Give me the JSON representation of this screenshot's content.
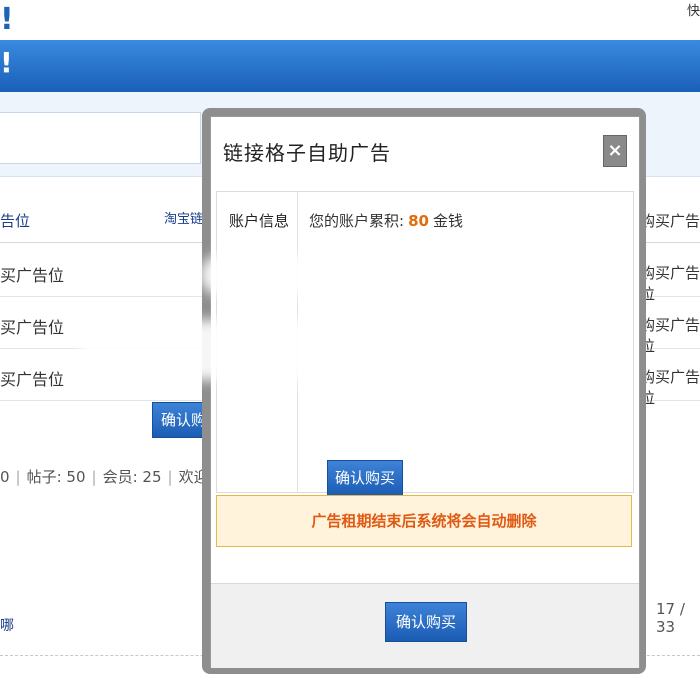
{
  "header": {
    "exclaim": "!",
    "corner_char": "快"
  },
  "table": {
    "head_left": "告位",
    "head_mid": "淘宝链接",
    "head_right": "购买广告",
    "rows": [
      {
        "left": "买广告位",
        "right": "购买广告位"
      },
      {
        "left": "买广告位",
        "right": "购买广告位"
      },
      {
        "left": "买广告位",
        "right": "购买广告位"
      }
    ]
  },
  "stats": {
    "p1": "0",
    "p2": "帖子: 50",
    "p3": "会员: 25",
    "p4": "欢迎新会"
  },
  "footer": {
    "left_text": "哪",
    "page_count": "17 / 33"
  },
  "buttons": {
    "confirm_buy": "确认购买",
    "buy": "购买"
  },
  "modal": {
    "title": "链接格子自助广告",
    "close": "×",
    "account_label": "账户信息",
    "account_text": "您的账户累积:",
    "account_amount": "80",
    "account_unit": "金钱",
    "confirm_mid": "确认购买",
    "notice": "广告租期结束后系统将会自动删除",
    "confirm_footer": "确认购买"
  }
}
